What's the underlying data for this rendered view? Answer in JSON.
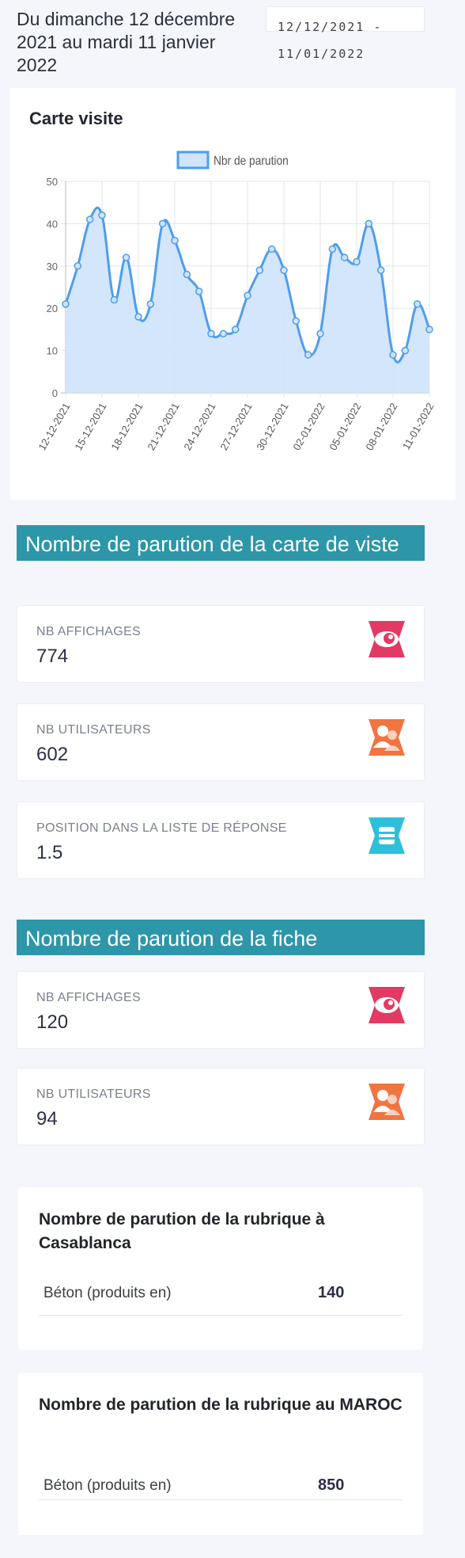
{
  "header": {
    "period_text": "Du dimanche 12 décembre 2021 au mardi 11 janvier 2022",
    "range_start": "12/12/2021 -",
    "range_end": "11/01/2022"
  },
  "chart_card": {
    "title": "Carte visite"
  },
  "chart_data": {
    "type": "area",
    "title": "Carte visite",
    "legend": "Nbr de parution",
    "legend_placement": "top",
    "ylim": [
      0,
      50
    ],
    "y_ticks": [
      0,
      10,
      20,
      30,
      40,
      50
    ],
    "x_tick_labels": [
      "12-12-2021",
      "15-12-2021",
      "18-12-2021",
      "21-12-2021",
      "24-12-2021",
      "27-12-2021",
      "30-12-2021",
      "02-01-2022",
      "05-01-2022",
      "08-01-2022",
      "11-01-2022"
    ],
    "x": [
      "12-12-2021",
      "13-12-2021",
      "14-12-2021",
      "15-12-2021",
      "16-12-2021",
      "17-12-2021",
      "18-12-2021",
      "19-12-2021",
      "20-12-2021",
      "21-12-2021",
      "22-12-2021",
      "23-12-2021",
      "24-12-2021",
      "25-12-2021",
      "26-12-2021",
      "27-12-2021",
      "28-12-2021",
      "29-12-2021",
      "30-12-2021",
      "31-12-2021",
      "01-01-2022",
      "02-01-2022",
      "03-01-2022",
      "04-01-2022",
      "05-01-2022",
      "06-01-2022",
      "07-01-2022",
      "08-01-2022",
      "09-01-2022",
      "10-01-2022",
      "11-01-2022"
    ],
    "series": [
      {
        "name": "Nbr de parution",
        "values": [
          21,
          30,
          41,
          42,
          22,
          32,
          18,
          21,
          40,
          36,
          28,
          24,
          14,
          14,
          15,
          23,
          29,
          34,
          29,
          17,
          9,
          14,
          34,
          32,
          31,
          40,
          29,
          9,
          10,
          21,
          15
        ]
      }
    ],
    "grid": true,
    "line_color": "#4f9ded",
    "fill_color": "#cfe3fb"
  },
  "section_carte": {
    "title": "Nombre de parution de la carte de viste",
    "stats": [
      {
        "label": "NB AFFICHAGES",
        "value": "774",
        "icon": "eye-icon"
      },
      {
        "label": "NB UTILISATEURS",
        "value": "602",
        "icon": "users-icon"
      },
      {
        "label": "POSITION DANS LA LISTE DE RÉPONSE",
        "value": "1.5",
        "icon": "list-position-icon"
      }
    ]
  },
  "section_fiche": {
    "title": "Nombre de parution de la fiche",
    "stats": [
      {
        "label": "NB AFFICHAGES",
        "value": "120",
        "icon": "eye-icon"
      },
      {
        "label": "NB UTILISATEURS",
        "value": "94",
        "icon": "users-icon"
      }
    ]
  },
  "rubrique_casablanca": {
    "title": "Nombre de parution de la rubrique à Casablanca",
    "rows": [
      {
        "name": "Béton (produits en)",
        "value": "140"
      }
    ]
  },
  "rubrique_maroc": {
    "title": "Nombre de parution de la rubrique au MAROC",
    "rows": [
      {
        "name": "Béton (produits en)",
        "value": "850"
      }
    ]
  },
  "colors": {
    "section_header": "#2d96a9",
    "eye_icon": "#e23a62",
    "users_icon": "#f07541",
    "position_icon": "#2ec0da"
  }
}
